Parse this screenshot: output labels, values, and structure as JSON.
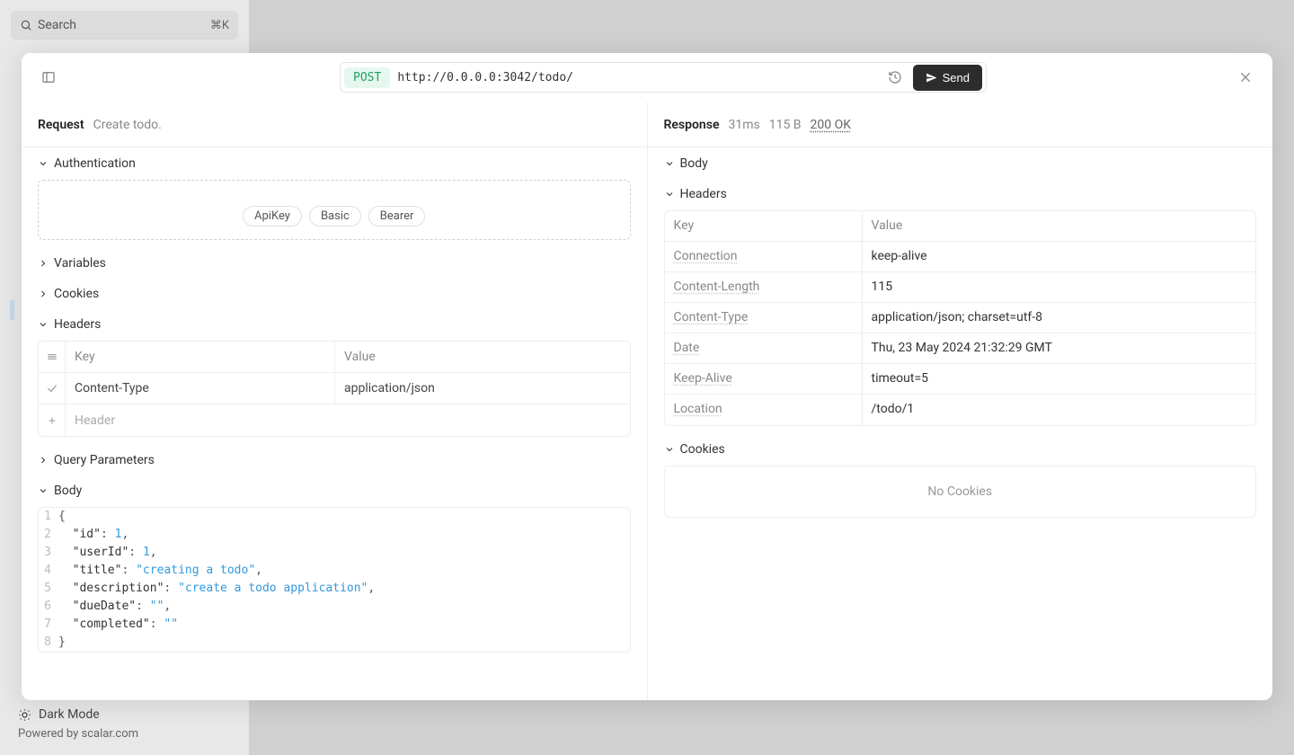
{
  "search": {
    "placeholder": "Search",
    "kbd": "⌘K"
  },
  "footer": {
    "darkMode": "Dark Mode",
    "powered": "Powered by scalar.com"
  },
  "request": {
    "method": "POST",
    "url": "http://0.0.0.0:3042/todo/",
    "sendLabel": "Send",
    "title": "Request",
    "subtitle": "Create todo.",
    "sections": {
      "auth": {
        "label": "Authentication",
        "types": [
          "ApiKey",
          "Basic",
          "Bearer"
        ]
      },
      "variables": {
        "label": "Variables"
      },
      "cookies": {
        "label": "Cookies"
      },
      "headers": {
        "label": "Headers",
        "keyHeader": "Key",
        "valHeader": "Value",
        "rows": [
          {
            "key": "Content-Type",
            "val": "application/json"
          }
        ],
        "addPlaceholder": "Header"
      },
      "query": {
        "label": "Query Parameters"
      },
      "body": {
        "label": "Body",
        "json": {
          "id": 1,
          "userId": 1,
          "title": "creating a todo",
          "description": "create a todo application",
          "dueDate": "",
          "completed": ""
        }
      }
    }
  },
  "response": {
    "title": "Response",
    "time": "31ms",
    "size": "115 B",
    "status": "200 OK",
    "sections": {
      "body": {
        "label": "Body"
      },
      "headers": {
        "label": "Headers",
        "keyHeader": "Key",
        "valHeader": "Value",
        "rows": [
          {
            "key": "Connection",
            "val": "keep-alive"
          },
          {
            "key": "Content-Length",
            "val": "115"
          },
          {
            "key": "Content-Type",
            "val": "application/json; charset=utf-8"
          },
          {
            "key": "Date",
            "val": "Thu, 23 May 2024 21:32:29 GMT"
          },
          {
            "key": "Keep-Alive",
            "val": "timeout=5"
          },
          {
            "key": "Location",
            "val": "/todo/1"
          }
        ]
      },
      "cookies": {
        "label": "Cookies",
        "empty": "No Cookies"
      }
    }
  }
}
